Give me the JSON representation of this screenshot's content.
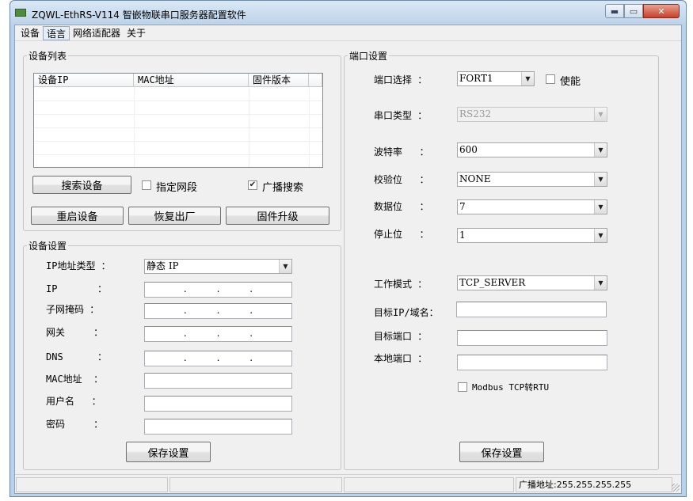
{
  "window": {
    "title": "ZQWL-EthRS-V114  智嵌物联串口服务器配置软件",
    "close_glyph": "✕",
    "minimize_glyph": "▬",
    "maximize_glyph": "▭"
  },
  "menu": [
    "设备",
    "语言",
    "网络适配器",
    "关于"
  ],
  "device_list": {
    "legend": "设备列表",
    "columns": [
      "设备IP",
      "MAC地址",
      "固件版本"
    ],
    "search_button": "搜索设备",
    "specify_segment": {
      "label": "指定网段",
      "checked": false
    },
    "broadcast_search": {
      "label": "广播搜索",
      "checked": true
    },
    "restart_button": "重启设备",
    "factory_button": "恢复出厂",
    "upgrade_button": "固件升级"
  },
  "device_settings": {
    "legend": "设备设置",
    "ip_type_label": "IP地址类型 ：",
    "ip_type_value": "静态 IP",
    "ip_label": "IP       ：",
    "subnet_label": "子网掩码 ：",
    "gateway_label": "网关     ：",
    "dns_label": "DNS      ：",
    "mac_label": "MAC地址  ：",
    "username_label": "用户名   ：",
    "password_label": "密码     ：",
    "ip_dot": ".",
    "save_button": "保存设置"
  },
  "port_settings": {
    "legend": "端口设置",
    "port_select_label": "端口选择 ：",
    "port_select_value": "FORT1",
    "enable_label": "使能",
    "enable_checked": false,
    "serial_type_label": "串口类型 ：",
    "serial_type_value": "RS232",
    "baud_label": "波特率   ：",
    "baud_value": "600",
    "parity_label": "校验位   ：",
    "parity_value": "NONE",
    "databits_label": "数据位   ：",
    "databits_value": "7",
    "stopbits_label": "停止位   ：",
    "stopbits_value": "1",
    "workmode_label": "工作模式 ：",
    "workmode_value": "TCP_SERVER",
    "target_ip_label": "目标IP/域名：",
    "target_port_label": "目标端口 ：",
    "local_port_label": "本地端口 ：",
    "modbus_label": "Modbus TCP转RTU",
    "modbus_checked": false,
    "save_button": "保存设置"
  },
  "statusbar": {
    "broadcast": "广播地址:255.255.255.255"
  },
  "checkmark_glyph": "✔",
  "dropdown_glyph": "▼"
}
